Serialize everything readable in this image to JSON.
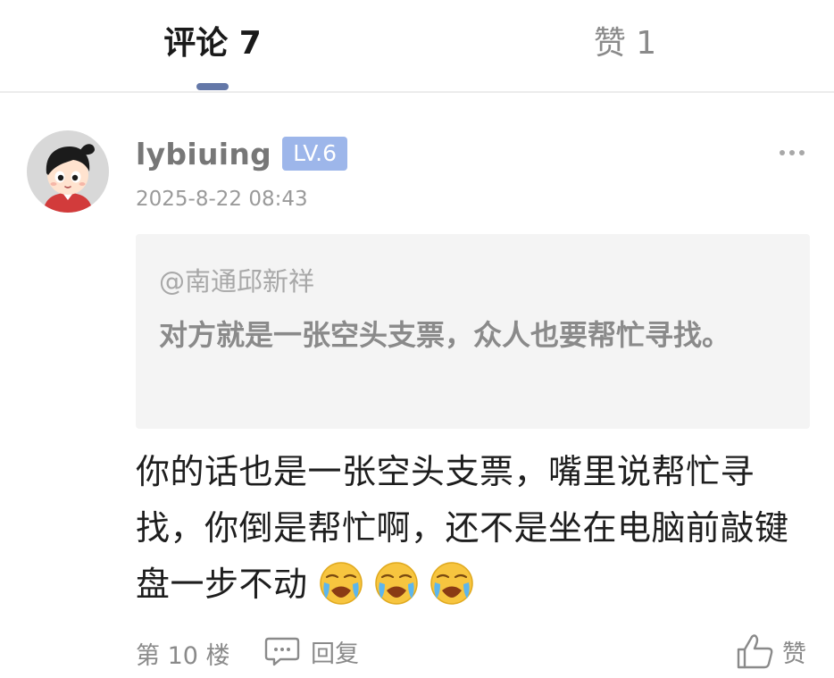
{
  "tabs": {
    "comments_label": "评论 7",
    "likes_label": "赞 1"
  },
  "comment": {
    "username": "lybiuing",
    "level": "LV.6",
    "timestamp": "2025-8-22 08:43",
    "quote": {
      "author": "@南通邱新祥",
      "text": "对方就是一张空头支票，众人也要帮忙寻找。"
    },
    "body": "你的话也是一张空头支票，嘴里说帮忙寻找，你倒是帮忙啊，还不是坐在电脑前敲键盘一步不动",
    "emojis": [
      "crying-emoji",
      "crying-emoji",
      "crying-emoji"
    ],
    "floor": "第 10 楼",
    "reply_label": "回复",
    "like_label": "赞"
  },
  "icons": {
    "more": "more-dots-icon",
    "reply": "comment-bubble-icon",
    "like": "thumbs-up-icon"
  },
  "colors": {
    "accent": "#6478a8",
    "level_badge": "#9db6ea",
    "quote_background": "#f4f4f4",
    "muted_text": "#8a8a8a"
  }
}
